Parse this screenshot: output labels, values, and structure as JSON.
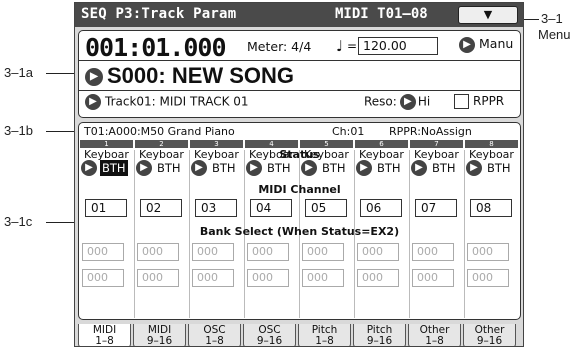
{
  "callouts": {
    "menu": "3–1",
    "menu_sub": "Menu",
    "song": "3–1a",
    "track": "3–1b",
    "grid": "3–1c"
  },
  "title": {
    "left": "SEQ  P3:Track Param",
    "right": "MIDI T01–08",
    "menu_glyph": "⌵"
  },
  "locator": {
    "position": "001:01.000",
    "meter": "Meter: 4/4",
    "tempo_note": "♩",
    "tempo_eq": "=",
    "tempo_value": "120.00",
    "tempo_mode": "Manu"
  },
  "song": {
    "label": "S000: NEW SONG"
  },
  "track": {
    "label": "Track01: MIDI TRACK 01",
    "reso_label": "Reso:",
    "reso_value": "Hi",
    "rppr_label": "RPPR"
  },
  "info": {
    "track_program": "T01:A000:M50 Grand Piano",
    "ch": "Ch:01",
    "rppr": "RPPR:NoAssign"
  },
  "columns": [
    {
      "num": "1",
      "name": "Keyboar",
      "status": "BTH",
      "channel": "01",
      "msb": "000",
      "lsb": "000"
    },
    {
      "num": "2",
      "name": "Keyboar",
      "status": "BTH",
      "channel": "02",
      "msb": "000",
      "lsb": "000"
    },
    {
      "num": "3",
      "name": "Keyboar",
      "status": "BTH",
      "channel": "03",
      "msb": "000",
      "lsb": "000"
    },
    {
      "num": "4",
      "name": "Keyboar",
      "status": "BTH",
      "channel": "04",
      "msb": "000",
      "lsb": "000"
    },
    {
      "num": "5",
      "name": "Keyboar",
      "status": "BTH",
      "channel": "05",
      "msb": "000",
      "lsb": "000"
    },
    {
      "num": "6",
      "name": "Keyboar",
      "status": "BTH",
      "channel": "06",
      "msb": "000",
      "lsb": "000"
    },
    {
      "num": "7",
      "name": "Keyboar",
      "status": "BTH",
      "channel": "07",
      "msb": "000",
      "lsb": "000"
    },
    {
      "num": "8",
      "name": "Keyboar",
      "status": "BTH",
      "channel": "08",
      "msb": "000",
      "lsb": "000"
    }
  ],
  "sections": {
    "status": "Status",
    "channel": "MIDI Channel",
    "bank": "Bank Select (When Status=EX2)"
  },
  "tabs": [
    {
      "top": "MIDI",
      "bottom": "1–8"
    },
    {
      "top": "MIDI",
      "bottom": "9–16"
    },
    {
      "top": "OSC",
      "bottom": "1–8"
    },
    {
      "top": "OSC",
      "bottom": "9–16"
    },
    {
      "top": "Pitch",
      "bottom": "1–8"
    },
    {
      "top": "Pitch",
      "bottom": "9–16"
    },
    {
      "top": "Other",
      "bottom": "1–8"
    },
    {
      "top": "Other",
      "bottom": "9–16"
    }
  ]
}
